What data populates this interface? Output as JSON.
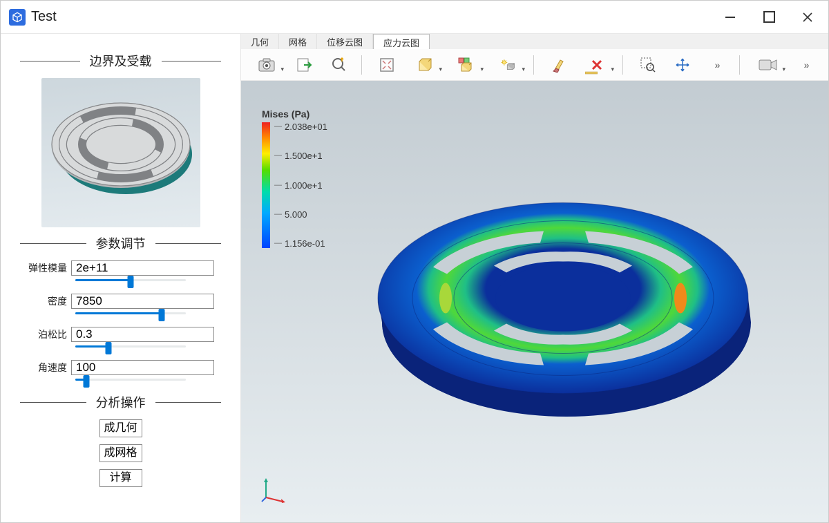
{
  "window": {
    "title": "Test"
  },
  "sidebar": {
    "section_boundary": "边界及受载",
    "section_params": "参数调节",
    "section_analysis": "分析操作"
  },
  "params": {
    "elastic_modulus": {
      "label": "弹性模量",
      "value": "2e+11",
      "slider": 50
    },
    "density": {
      "label": "密度",
      "value": "7850",
      "slider": 78
    },
    "poisson": {
      "label": "泊松比",
      "value": "0.3",
      "slider": 30
    },
    "angular_velocity": {
      "label": "角速度",
      "value": "100",
      "slider": 10
    }
  },
  "ops": {
    "gen_geom": "成几何",
    "gen_mesh": "成网格",
    "compute": "计算"
  },
  "tabs": [
    "几何",
    "网格",
    "位移云图",
    "应力云图"
  ],
  "legend": {
    "title": "Mises (Pa)",
    "ticks": [
      "2.038e+01",
      "1.500e+1",
      "1.000e+1",
      "5.000",
      "1.156e-01"
    ]
  },
  "colors": {
    "accent": "#0078d7"
  }
}
